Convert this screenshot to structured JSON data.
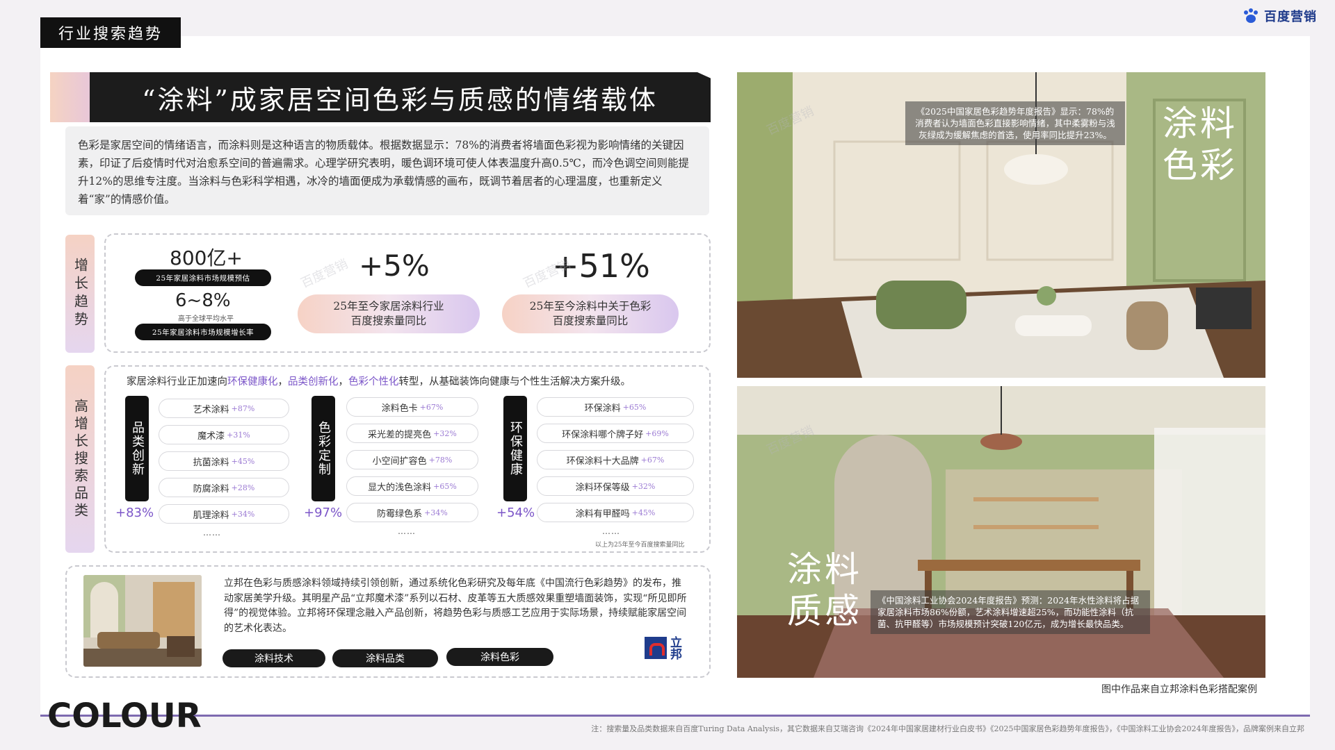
{
  "section_tag": "行业搜索趋势",
  "brand": "百度营销",
  "headline": "“涂料”成家居空间色彩与质感的情绪载体",
  "intro": "色彩是家居空间的情绪语言，而涂料则是这种语言的物质载体。根据数据显示：78%的消费者将墙面色彩视为影响情绪的关键因素，印证了后疫情时代对治愈系空间的普遍需求。心理学研究表明，暖色调环境可使人体表温度升高0.5℃，而冷色调空间则能提升12%的思维专注度。当涂料与色彩科学相遇，冰冷的墙面便成为承载情感的画布，既调节着居者的心理温度，也重新定义着“家”的情感价值。",
  "growth": {
    "label": "增长趋势",
    "market_value": "800亿+",
    "market_value_note": "25年家居涂料市场规模预估",
    "growth_rate": "6~8%",
    "growth_rate_sub": "高于全球平均水平",
    "growth_rate_note": "25年家居涂料市场规模增长率",
    "stat2_value": "+5%",
    "stat2_line1": "25年至今家居涂料行业",
    "stat2_line2": "百度搜索量同比",
    "stat3_value": "+51%",
    "stat3_line1": "25年至今涂料中关于色彩",
    "stat3_line2": "百度搜索量同比"
  },
  "categories": {
    "label": "高增长搜索品类",
    "intro_prefix": "家居涂料行业正加速向",
    "intro_hl1": "环保健康化",
    "intro_sep1": "，",
    "intro_hl2": "品类创新化",
    "intro_sep2": "，",
    "intro_hl3": "色彩个性化",
    "intro_suffix": "转型，从基础装饰向健康与个性生活解决方案升级。",
    "groups": [
      {
        "name": "品类创新",
        "pct": "+83%",
        "items": [
          {
            "term": "艺术涂料",
            "growth": "+87%"
          },
          {
            "term": "魔术漆",
            "growth": "+31%"
          },
          {
            "term": "抗菌涂料",
            "growth": "+45%"
          },
          {
            "term": "防腐涂料",
            "growth": "+28%"
          },
          {
            "term": "肌理涂料",
            "growth": "+34%"
          }
        ]
      },
      {
        "name": "色彩定制",
        "pct": "+97%",
        "items": [
          {
            "term": "涂料色卡",
            "growth": "+67%"
          },
          {
            "term": "采光差的提亮色",
            "growth": "+32%"
          },
          {
            "term": "小空间扩容色",
            "growth": "+78%"
          },
          {
            "term": "显大的浅色涂料",
            "growth": "+65%"
          },
          {
            "term": "防霉绿色系",
            "growth": "+34%"
          }
        ]
      },
      {
        "name": "环保健康",
        "pct": "+54%",
        "items": [
          {
            "term": "环保涂料",
            "growth": "+65%"
          },
          {
            "term": "环保涂料哪个牌子好",
            "growth": "+69%"
          },
          {
            "term": "环保涂料十大品牌",
            "growth": "+67%"
          },
          {
            "term": "涂料环保等级",
            "growth": "+32%"
          },
          {
            "term": "涂料有甲醛吗",
            "growth": "+45%"
          }
        ]
      }
    ],
    "ellipsis": "……",
    "source_note": "以上为25年至今百度搜索量同比"
  },
  "brand_case": {
    "text": "立邦在色彩与质感涂料领域持续引领创新，通过系统化色彩研究及每年底《中国流行色彩趋势》的发布，推动家居美学升级。其明星产品“立邦魔术漆”系列以石材、皮革等五大质感效果重塑墙面装饰，实现“所见即所得”的视觉体验。立邦将环保理念融入产品创新，将趋势色彩与质感工艺应用于实际场景，持续赋能家居空间的艺术化表达。",
    "tags": [
      "涂料技术",
      "涂料品类",
      "涂料色彩"
    ],
    "logo_text": "立邦"
  },
  "photos": {
    "top_caption": "《2025中国家居色彩趋势年度报告》显示：78%的消费者认为墙面色彩直接影响情绪，其中柔雾粉与浅灰绿成为缓解焦虑的首选，使用率同比提升23%。",
    "top_label_line1": "涂料",
    "top_label_line2": "色彩",
    "bottom_caption": "《中国涂料工业协会2024年度报告》预测：2024年水性涂料将占据家居涂料市场86%份额，艺术涂料增速超25%，而功能性涂料（抗菌、抗甲醛等）市场规模预计突破120亿元，成为增长最快品类。",
    "bottom_label_line1": "涂料",
    "bottom_label_line2": "质感",
    "credit": "图中作品来自立邦涂料色彩搭配案例"
  },
  "colour_word": "COLOUR",
  "footnote": "注：搜索量及品类数据来自百度Turing Data Analysis，其它数据来自艾瑞咨询《2024年中国家居建材行业白皮书》《2025中国家居色彩趋势年度报告》，《中国涂料工业协会2024年度报告》，品牌案例来自立邦",
  "watermark": "百度营销",
  "colors": {
    "accent_purple": "#7b55c8",
    "dark": "#111111",
    "sage_green": "#a9b885"
  }
}
